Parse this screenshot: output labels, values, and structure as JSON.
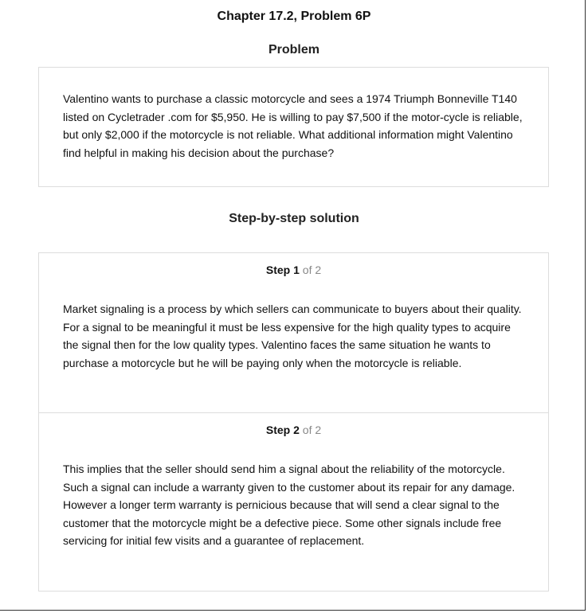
{
  "header": {
    "chapter_title": "Chapter 17.2, Problem 6P"
  },
  "problem": {
    "heading": "Problem",
    "text": "Valentino wants to purchase a classic motorcycle and sees a 1974 Triumph Bonneville T140 listed on Cycletrader .com for $5,950. He is willing to pay $7,500 if the motor-cycle is reliable, but only $2,000 if the motorcycle is not reliable. What additional information might Valentino find helpful in making his decision about the purchase?"
  },
  "solution": {
    "heading": "Step-by-step solution",
    "steps": [
      {
        "label": "Step",
        "number": "1",
        "of_total": "of 2",
        "text": "Market signaling is a process by which sellers can communicate to buyers about their quality. For a signal to be meaningful it must be less expensive for the high quality types to acquire the signal then for the low quality types. Valentino faces the same situation he wants to purchase a motorcycle but he will be paying only when the motorcycle is reliable."
      },
      {
        "label": "Step",
        "number": "2",
        "of_total": "of 2",
        "text": "This implies that the seller should send him a signal about the reliability of the motorcycle. Such a signal can include a warranty given to the customer about its repair for any damage. However a longer term warranty is pernicious because that will send a clear signal to the customer that the motorcycle might be a defective piece. Some other signals include free servicing for initial few visits and a guarantee of replacement."
      }
    ]
  }
}
